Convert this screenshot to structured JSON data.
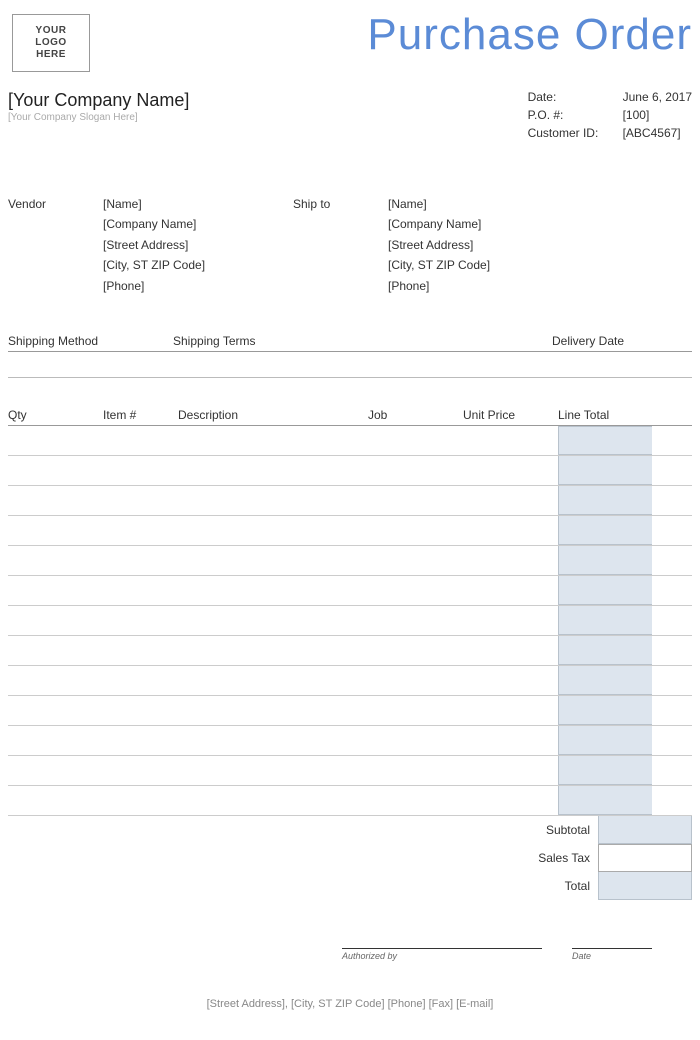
{
  "header": {
    "logo_line1": "YOUR LOGO",
    "logo_line2": "HERE",
    "title": "Purchase Order"
  },
  "company": {
    "name": "[Your Company Name]",
    "slogan": "[Your Company Slogan Here]"
  },
  "meta": {
    "date_label": "Date:",
    "date_value": "June 6, 2017",
    "po_label": "P.O. #:",
    "po_value": "[100]",
    "cust_label": "Customer ID:",
    "cust_value": "[ABC4567]"
  },
  "vendor": {
    "label": "Vendor",
    "name": "[Name]",
    "company": "[Company Name]",
    "street": "[Street Address]",
    "city": "[City, ST  ZIP Code]",
    "phone": "[Phone]"
  },
  "shipto": {
    "label": "Ship to",
    "name": "[Name]",
    "company": "[Company Name]",
    "street": "[Street Address]",
    "city": "[City, ST  ZIP Code]",
    "phone": "[Phone]"
  },
  "shipping": {
    "method_label": "Shipping Method",
    "terms_label": "Shipping Terms",
    "delivery_label": "Delivery Date"
  },
  "items": {
    "headers": {
      "qty": "Qty",
      "item": "Item #",
      "desc": "Description",
      "job": "Job",
      "unit": "Unit Price",
      "total": "Line Total"
    },
    "row_count": 13
  },
  "totals": {
    "subtotal_label": "Subtotal",
    "tax_label": "Sales Tax",
    "total_label": "Total"
  },
  "signature": {
    "auth_label": "Authorized by",
    "date_label": "Date"
  },
  "footer": "[Street Address], [City, ST  ZIP Code]  [Phone]  [Fax]  [E-mail]"
}
